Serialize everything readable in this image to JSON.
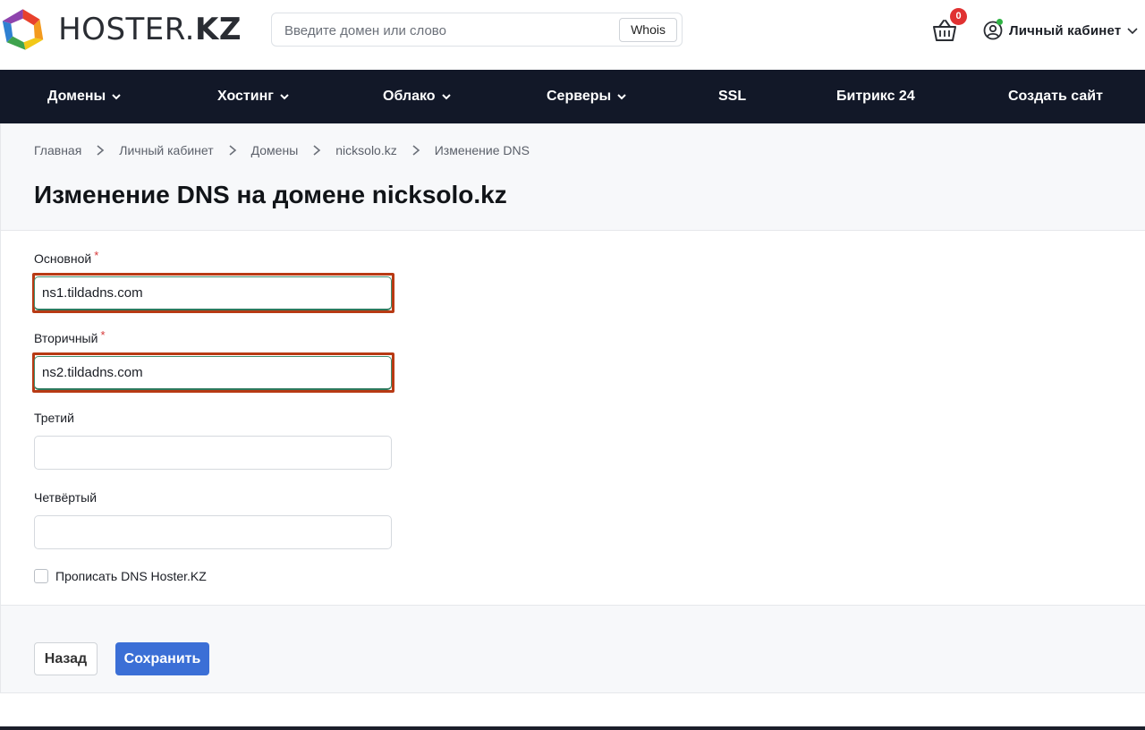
{
  "brand": {
    "logo_text_light": "HOSTER.",
    "logo_text_bold": "KZ"
  },
  "search": {
    "placeholder": "Введите домен или слово",
    "button_label": "Whois"
  },
  "cart": {
    "count": "0"
  },
  "account": {
    "label": "Личный кабинет"
  },
  "nav": {
    "items": [
      {
        "label": "Домены",
        "dropdown": true
      },
      {
        "label": "Хостинг",
        "dropdown": true
      },
      {
        "label": "Облако",
        "dropdown": true
      },
      {
        "label": "Серверы",
        "dropdown": true
      },
      {
        "label": "SSL",
        "dropdown": false
      },
      {
        "label": "Битрикс 24",
        "dropdown": false
      },
      {
        "label": "Создать сайт",
        "dropdown": false
      }
    ]
  },
  "breadcrumb": [
    "Главная",
    "Личный кабинет",
    "Домены",
    "nicksolo.kz",
    "Изменение DNS"
  ],
  "page": {
    "title": "Изменение DNS на домене nicksolo.kz"
  },
  "form": {
    "primary": {
      "label": "Основной",
      "required": "*",
      "value": "ns1.tildadns.com"
    },
    "secondary": {
      "label": "Вторичный",
      "required": "*",
      "value": "ns2.tildadns.com"
    },
    "third": {
      "label": "Третий",
      "value": ""
    },
    "fourth": {
      "label": "Четвёртый",
      "value": ""
    },
    "checkbox": {
      "label": "Прописать DNS Hoster.KZ",
      "checked": false
    }
  },
  "actions": {
    "back_label": "Назад",
    "save_label": "Сохранить"
  },
  "colors": {
    "nav_bg": "#121828",
    "primary_button": "#3b6fd6",
    "badge": "#e03131",
    "highlight": "#b83a14"
  }
}
